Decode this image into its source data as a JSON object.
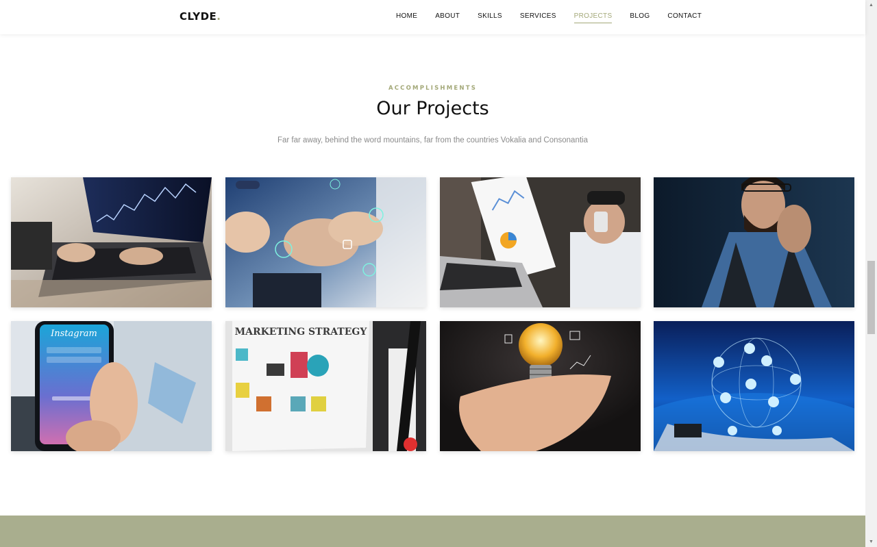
{
  "nav": {
    "brand": "CLYDE",
    "brand_dot": ".",
    "links": [
      "HOME",
      "ABOUT",
      "SKILLS",
      "SERVICES",
      "PROJECTS",
      "BLOG",
      "CONTACT"
    ],
    "active": "PROJECTS"
  },
  "section": {
    "subheading": "ACCOMPLISHMENTS",
    "title": "Our Projects",
    "lead": "Far far away, behind the word mountains, far from the countries Vokalia and Consonantia"
  },
  "projects": {
    "card5_text": "Instagram",
    "card6_text": "MARKETING STRATEGY"
  },
  "colors": {
    "accent": "#a3a878",
    "band": "#a9ae8e",
    "text": "#111111",
    "muted": "#8a8a8a"
  }
}
